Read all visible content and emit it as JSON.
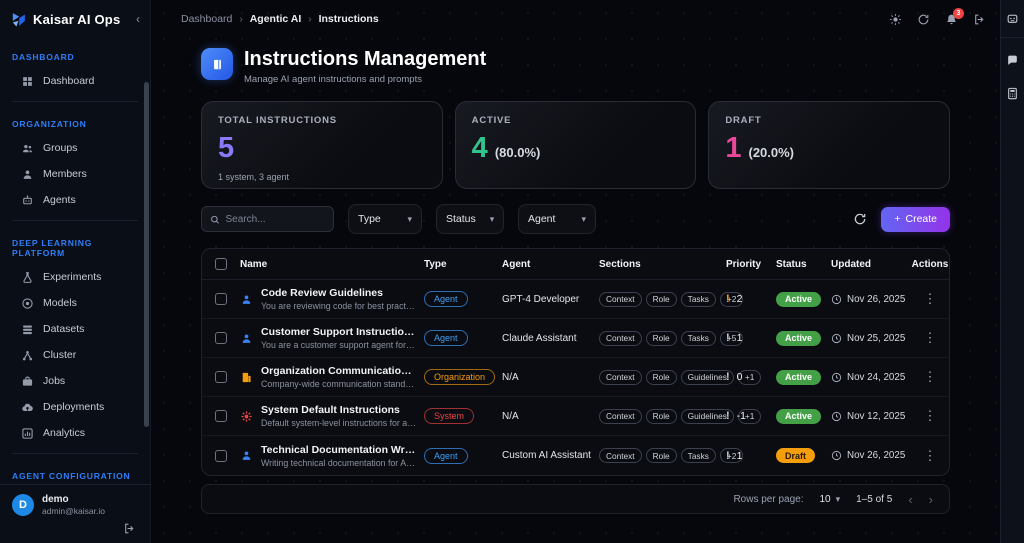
{
  "app": {
    "name": "Kaisar AI Ops",
    "collapse_icon": "‹"
  },
  "topbar": {
    "breadcrumbs": [
      "Dashboard",
      "Agentic AI",
      "Instructions"
    ],
    "notification_count": "3"
  },
  "sidebar": {
    "sections": [
      {
        "label": "DASHBOARD",
        "items": [
          {
            "label": "Dashboard",
            "icon": "dashboard-grid-icon"
          }
        ]
      },
      {
        "label": "ORGANIZATION",
        "items": [
          {
            "label": "Groups",
            "icon": "users-icon"
          },
          {
            "label": "Members",
            "icon": "user-icon"
          },
          {
            "label": "Agents",
            "icon": "robot-icon"
          }
        ]
      },
      {
        "label": "DEEP LEARNING PLATFORM",
        "items": [
          {
            "label": "Experiments",
            "icon": "flask-icon"
          },
          {
            "label": "Models",
            "icon": "target-icon"
          },
          {
            "label": "Datasets",
            "icon": "layers-icon"
          },
          {
            "label": "Cluster",
            "icon": "network-icon"
          },
          {
            "label": "Jobs",
            "icon": "briefcase-icon"
          },
          {
            "label": "Deployments",
            "icon": "cloud-upload-icon"
          },
          {
            "label": "Analytics",
            "icon": "bar-chart-icon"
          }
        ]
      },
      {
        "label": "AGENT CONFIGURATION",
        "items": []
      }
    ],
    "user": {
      "avatar_initial": "D",
      "name": "demo",
      "email": "admin@kaisar.io"
    }
  },
  "page": {
    "title": "Instructions Management",
    "subtitle": "Manage AI agent instructions and prompts"
  },
  "stats": [
    {
      "label": "TOTAL INSTRUCTIONS",
      "value": "5",
      "suffix": "",
      "sub": "1 system, 3 agent",
      "color": "#8b7af7"
    },
    {
      "label": "ACTIVE",
      "value": "4",
      "suffix": "(80.0%)",
      "sub": "",
      "color": "#31c48d"
    },
    {
      "label": "DRAFT",
      "value": "1",
      "suffix": "(20.0%)",
      "sub": "",
      "color": "#ec4899"
    }
  ],
  "filters": {
    "search_placeholder": "Search...",
    "type_label": "Type",
    "status_label": "Status",
    "agent_label": "Agent",
    "create_label": "Create"
  },
  "table": {
    "columns": [
      "Name",
      "Type",
      "Agent",
      "Sections",
      "Priority",
      "Status",
      "Updated",
      "Actions"
    ],
    "rows": [
      {
        "name": "Code Review Guidelines",
        "description": "You are reviewing code for best practices an...",
        "icon": "agent-person-icon",
        "type": "Agent",
        "type_kind": "agent",
        "agent": "GPT-4 Developer",
        "sections": [
          "Context",
          "Role",
          "Tasks",
          "+2"
        ],
        "priority": "2",
        "priority_level": "high",
        "status": "Active",
        "status_kind": "active",
        "updated": "Nov 26, 2025"
      },
      {
        "name": "Customer Support Instructions",
        "description": "You are a customer support agent for a soft...",
        "icon": "agent-person-icon",
        "type": "Agent",
        "type_kind": "agent",
        "agent": "Claude Assistant",
        "sections": [
          "Context",
          "Role",
          "Tasks",
          "+5"
        ],
        "priority": "1",
        "priority_level": "normal",
        "status": "Active",
        "status_kind": "active",
        "updated": "Nov 25, 2025"
      },
      {
        "name": "Organization Communication Style",
        "description": "Company-wide communication standards.",
        "icon": "building-icon",
        "type": "Organization",
        "type_kind": "organization",
        "agent": "N/A",
        "sections": [
          "Context",
          "Role",
          "Guidelines",
          "+1"
        ],
        "priority": "0",
        "priority_level": "normal",
        "status": "Active",
        "status_kind": "active",
        "updated": "Nov 24, 2025"
      },
      {
        "name": "System Default Instructions",
        "description": "Default system-level instructions for all agents.",
        "icon": "gear-icon",
        "type": "System",
        "type_kind": "system",
        "agent": "N/A",
        "sections": [
          "Context",
          "Role",
          "Guidelines",
          "+1"
        ],
        "priority": "-1",
        "priority_level": "normal",
        "status": "Active",
        "status_kind": "active",
        "updated": "Nov 12, 2025"
      },
      {
        "name": "Technical Documentation Writer",
        "description": "Writing technical documentation for APIs an...",
        "icon": "agent-person-icon",
        "type": "Agent",
        "type_kind": "agent",
        "agent": "Custom AI Assistant",
        "sections": [
          "Context",
          "Role",
          "Tasks",
          "+2"
        ],
        "priority": "1",
        "priority_level": "normal",
        "status": "Draft",
        "status_kind": "draft",
        "updated": "Nov 26, 2025"
      }
    ],
    "pagination": {
      "rows_per_page_label": "Rows per page:",
      "rows_per_page": "10",
      "range": "1–5 of 5"
    }
  },
  "colors": {
    "accent_blue": "#3b82f6",
    "type_agent": "#3ea0f7",
    "type_organization": "#f59e0b",
    "type_system": "#ef4444",
    "status_active": "#43a047",
    "status_draft": "#f59e0b",
    "notification_badge": "#ef4444"
  }
}
